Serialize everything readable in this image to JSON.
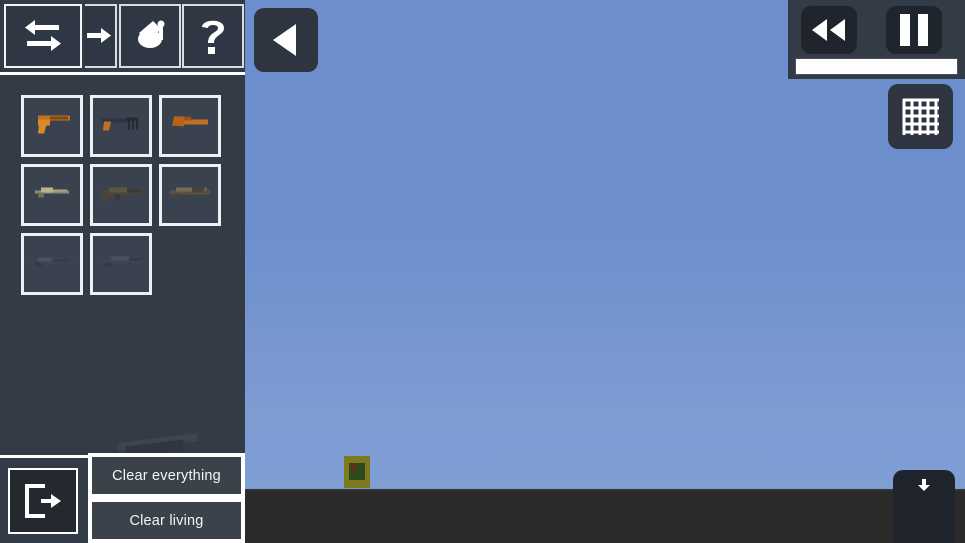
{
  "world": {
    "sky_color": "#6c8ecc",
    "ground_color": "#2b2b2b",
    "entities": [
      {
        "name": "crate-entity",
        "body_color": "#7d7a22",
        "inner_color": "#2f4a1e"
      }
    ]
  },
  "toolbar": {
    "slots": [
      {
        "icon": "swap-arrows-icon",
        "label": "Swap",
        "active": true
      },
      {
        "icon": "arrow-right-icon",
        "label": "Move",
        "active": false
      },
      {
        "icon": "paint-bucket-icon",
        "label": "Paint",
        "active": false
      },
      {
        "icon": "question-mark-icon",
        "label": "Help",
        "active": false
      }
    ]
  },
  "item_grid": {
    "items": [
      {
        "name": "item-pistol",
        "label": "Pistol",
        "tint": "#c2701f"
      },
      {
        "name": "item-smg",
        "label": "SMG",
        "tint": "#c2701f"
      },
      {
        "name": "item-sawed-off",
        "label": "Sawed-Off",
        "tint": "#c2701f"
      },
      {
        "name": "item-compact-rifle",
        "label": "Compact Rifle",
        "tint": "#8d8d76"
      },
      {
        "name": "item-assault-rifle",
        "label": "Assault Rifle",
        "tint": "#4a4438"
      },
      {
        "name": "item-battle-rifle",
        "label": "Battle Rifle",
        "tint": "#5b5242"
      },
      {
        "name": "item-sniper-rifle",
        "label": "Sniper Rifle",
        "tint": "#3d4450"
      },
      {
        "name": "item-machine-gun",
        "label": "Machine Gun",
        "tint": "#3d4450"
      }
    ]
  },
  "held_preview": {
    "label": "Held weapon preview",
    "wood_color": "#8a5a2b",
    "metal_color": "#3d4452"
  },
  "bottom_panel": {
    "exit_label": "Exit",
    "clear_everything_label": "Clear everything",
    "clear_living_label": "Clear living"
  },
  "collapse": {
    "label": "Collapse panel",
    "icon": "triangle-left-icon"
  },
  "playback": {
    "rewind_label": "Rewind",
    "pause_label": "Pause",
    "timeline_fill_percent": 100
  },
  "grid_toggle": {
    "label": "Toggle grid",
    "icon": "grid-icon",
    "enabled": true
  },
  "bottom_right_panel": {
    "label": "Save",
    "icon": "download-icon"
  },
  "colors": {
    "panel_bg": "#333b47",
    "slot_bg": "#3a424f",
    "slot_border": "#eef1f4",
    "button_bg": "#3c424b",
    "button_text": "#f3f5f7",
    "dark_button": "#20242c",
    "accent_white": "#ffffff"
  }
}
